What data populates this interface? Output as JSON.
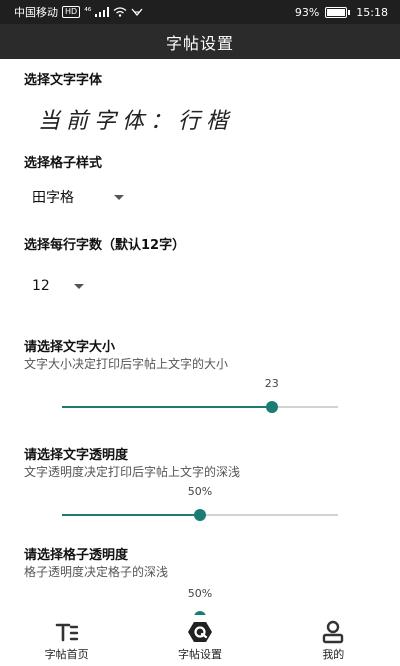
{
  "status_bar": {
    "carrier": "中国移动",
    "hd": "HD",
    "signal": "⁴⁶",
    "battery": "93%",
    "time": "15:18"
  },
  "app_bar": {
    "title": "字帖设置"
  },
  "font_section": {
    "title": "选择文字字体",
    "preview": "当前字体：行楷"
  },
  "grid_section": {
    "title": "选择格子样式",
    "selected": "田字格"
  },
  "per_row_section": {
    "title": "选择每行字数（默认12字）",
    "selected": "12"
  },
  "size_section": {
    "title": "请选择文字大小",
    "description": "文字大小决定打印后字帖上文字的大小",
    "value_label": "23",
    "fraction": 0.76
  },
  "text_opacity_section": {
    "title": "请选择文字透明度",
    "description": "文字透明度决定打印后字帖上文字的深浅",
    "value_label": "50%",
    "fraction": 0.5
  },
  "grid_opacity_section": {
    "title": "请选择格子透明度",
    "description": "格子透明度决定格子的深浅",
    "value_label": "50%",
    "fraction": 0.5
  },
  "bottom_nav": {
    "items": [
      {
        "label": "字帖首页",
        "icon": "text-format-icon"
      },
      {
        "label": "字帖设置",
        "icon": "settings-icon"
      },
      {
        "label": "我的",
        "icon": "person-icon"
      }
    ]
  },
  "colors": {
    "accent": "#1a7d74",
    "app_bar": "#2b2b2b",
    "status_bar": "#1f1f1f"
  }
}
